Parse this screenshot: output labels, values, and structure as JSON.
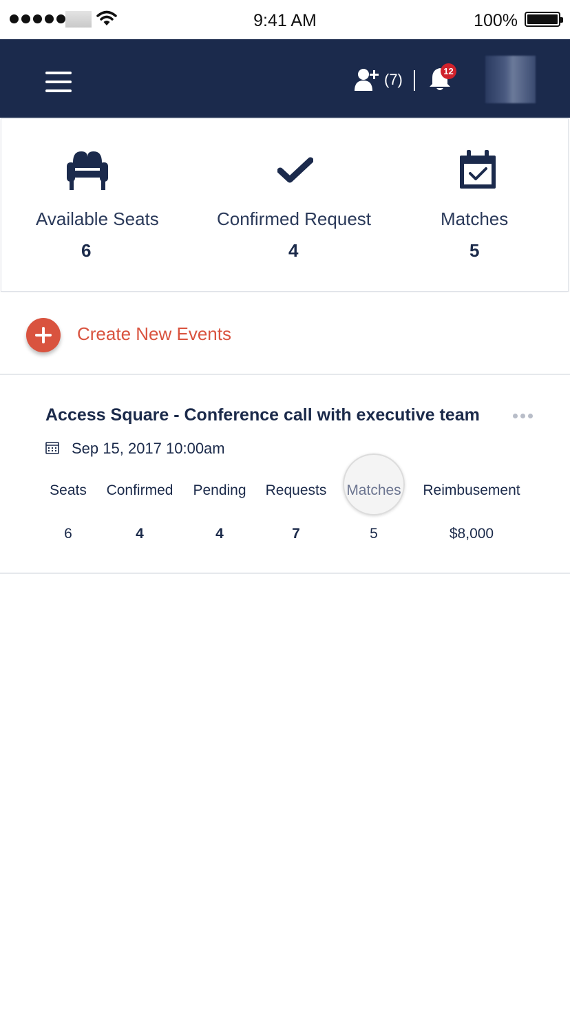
{
  "status_bar": {
    "time": "9:41 AM",
    "battery": "100%"
  },
  "navbar": {
    "add_user_count": "(7)",
    "notification_badge": "12",
    "colors": {
      "background": "#1b2a4c",
      "badge": "#d0222c"
    }
  },
  "stats": [
    {
      "icon": "armchair-icon",
      "label": "Available Seats",
      "value": "6"
    },
    {
      "icon": "checkmark-icon",
      "label": "Confirmed Request",
      "value": "4"
    },
    {
      "icon": "calendar-check-icon",
      "label": "Matches",
      "value": "5"
    }
  ],
  "create_event": {
    "label": "Create New Events",
    "accent": "#d9533f"
  },
  "event": {
    "title": "Access Square - Conference call with executive team",
    "date": "Sep 15, 2017  10:00am",
    "columns": [
      {
        "label": "Seats",
        "value": "6"
      },
      {
        "label": "Confirmed",
        "value": "4"
      },
      {
        "label": "Pending",
        "value": "4"
      },
      {
        "label": "Requests",
        "value": "7"
      },
      {
        "label": "Matches",
        "value": "5"
      },
      {
        "label": "Reimbusement",
        "value": "$8,000"
      }
    ]
  }
}
